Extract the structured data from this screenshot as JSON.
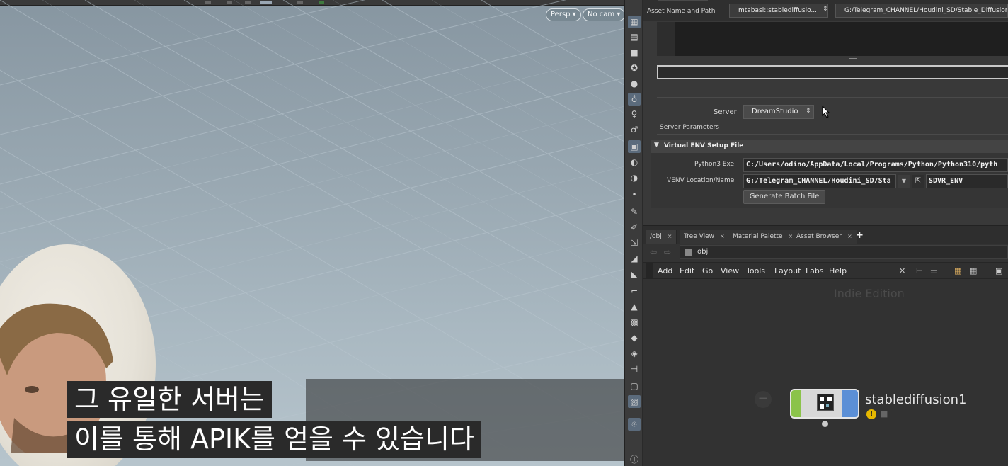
{
  "viewport": {
    "perspective_label": "Persp ▾",
    "camera_label": "No cam ▾"
  },
  "subtitles": {
    "line1": "그 유일한 서버는",
    "line2": "이를 통해 APIK를 얻을 수 있습니다"
  },
  "parameters": {
    "asset_label": "Asset Name and Path",
    "asset_name": "mtabasi::stablediffusio...",
    "asset_path": "G:/Telegram_CHANNEL/Houdini_SD/Stable_Diffusion",
    "server_label": "Server",
    "server_value": "DreamStudio",
    "server_params_label": "Server Parameters",
    "venv_header": "Virtual ENV Setup File",
    "python_label": "Python3 Exe",
    "python_value": "C:/Users/odino/AppData/Local/Programs/Python/Python310/pyth",
    "venv_label": "VENV Location/Name",
    "venv_location": "G:/Telegram_CHANNEL/Houdini_SD/Sta",
    "venv_name": "SDVR_ENV",
    "generate_button": "Generate Batch File"
  },
  "network": {
    "tabs": [
      {
        "label": "/obj"
      },
      {
        "label": "Tree View"
      },
      {
        "label": "Material Palette"
      },
      {
        "label": "Asset Browser"
      }
    ],
    "add_tab": "+",
    "path": "obj",
    "menu": [
      "Add",
      "Edit",
      "Go",
      "View",
      "Tools",
      "Layout",
      "Labs",
      "Help"
    ],
    "watermark": "Indie Edition",
    "node_name": "stablediffusion1"
  },
  "colors": {
    "accent_blue": "#5b8fd6",
    "warning_yellow": "#e6b800",
    "node_green": "#8bc34a"
  }
}
